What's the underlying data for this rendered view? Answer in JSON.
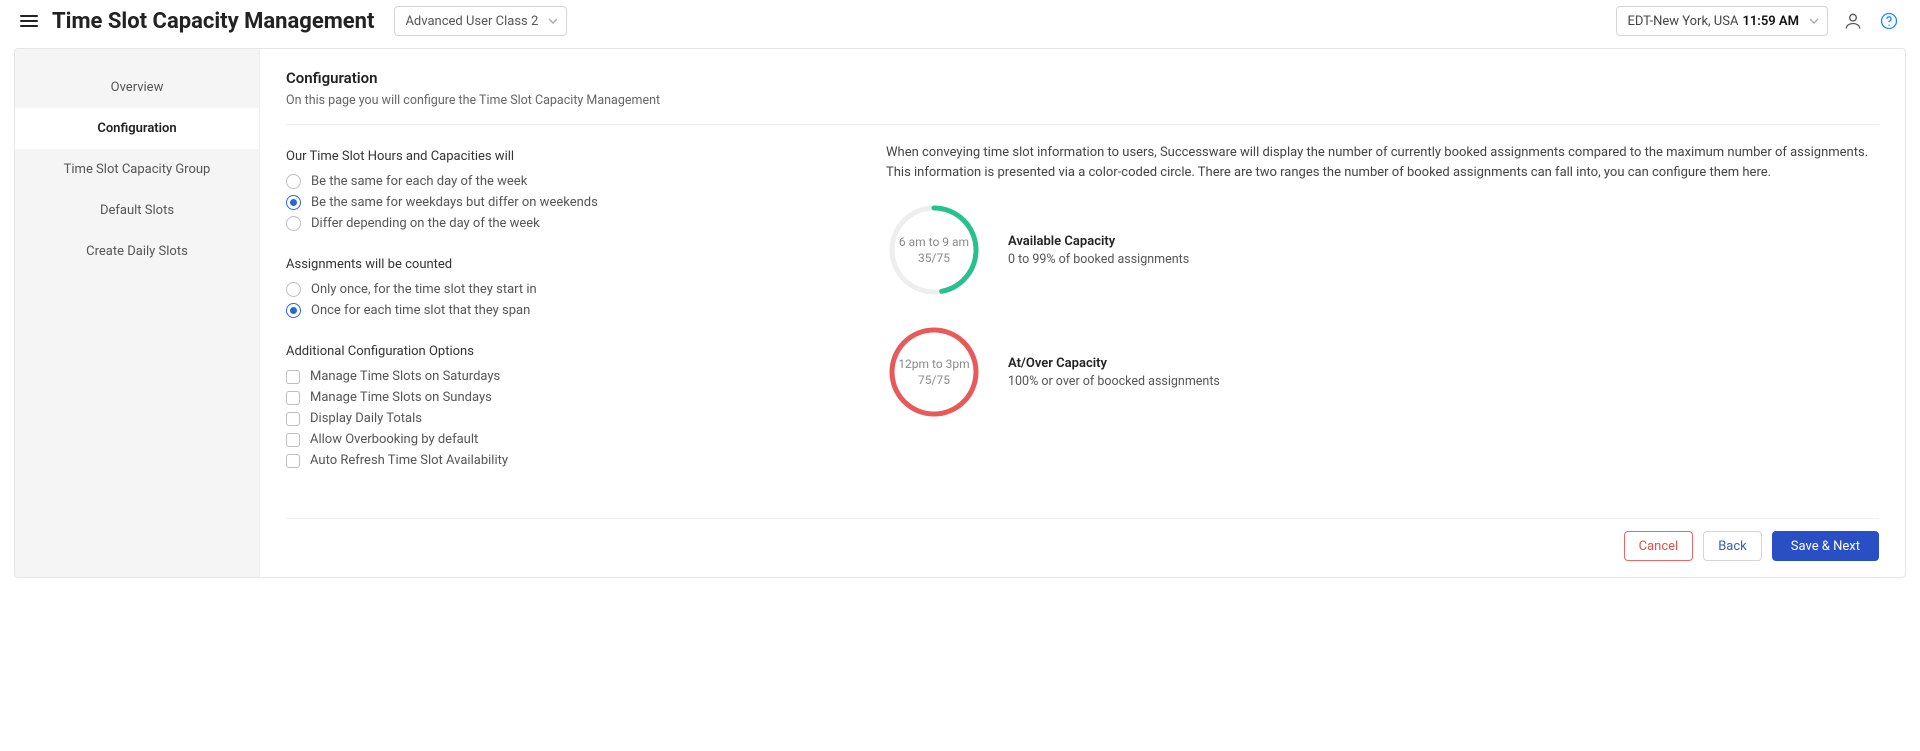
{
  "header": {
    "title": "Time Slot Capacity Management",
    "class_select": "Advanced User Class 2",
    "timezone_label": "EDT-New York, USA",
    "time": "11:59 AM"
  },
  "sidebar": {
    "items": [
      {
        "label": "Overview",
        "active": false
      },
      {
        "label": "Configuration",
        "active": true
      },
      {
        "label": "Time Slot Capacity Group",
        "active": false
      },
      {
        "label": "Default Slots",
        "active": false
      },
      {
        "label": "Create Daily Slots",
        "active": false
      }
    ]
  },
  "config": {
    "heading": "Configuration",
    "subheading": "On this page you will configure the Time Slot Capacity Management",
    "hours_group_title": "Our Time Slot Hours and Capacities will",
    "hours_options": [
      {
        "label": "Be the same for each day of the week",
        "checked": false
      },
      {
        "label": "Be the same for weekdays but differ on weekends",
        "checked": true
      },
      {
        "label": "Differ depending on the day of the week",
        "checked": false
      }
    ],
    "assign_group_title": "Assignments will be counted",
    "assign_options": [
      {
        "label": "Only once, for the time slot they start in",
        "checked": false
      },
      {
        "label": "Once for each time slot that they span",
        "checked": true
      }
    ],
    "additional_title": "Additional Configuration Options",
    "additional_options": [
      {
        "label": "Manage Time Slots on Saturdays",
        "checked": false
      },
      {
        "label": "Manage Time Slots on Sundays",
        "checked": false
      },
      {
        "label": "Display Daily Totals",
        "checked": false
      },
      {
        "label": "Allow Overbooking by default",
        "checked": false
      },
      {
        "label": "Auto Refresh Time Slot Availability",
        "checked": false
      }
    ]
  },
  "info": {
    "text": "When conveying time slot information to users, Successware will display the number of currently booked assignments compared to the maximum number of assignments. This information is presented via a color-coded circle. There are two ranges the number of booked assignments can fall into, you can configure them here.",
    "available": {
      "time": "6 am to 9 am",
      "ratio": "35/75",
      "title": "Available Capacity",
      "desc": "0 to 99% of booked assignments",
      "percent": 47,
      "color": "#27c08f"
    },
    "over": {
      "time": "12pm to 3pm",
      "ratio": "75/75",
      "title": "At/Over Capacity",
      "desc": "100% or over of boocked assignments",
      "percent": 100,
      "color": "#e85a5a"
    }
  },
  "footer": {
    "cancel": "Cancel",
    "back": "Back",
    "save_next": "Save & Next"
  }
}
